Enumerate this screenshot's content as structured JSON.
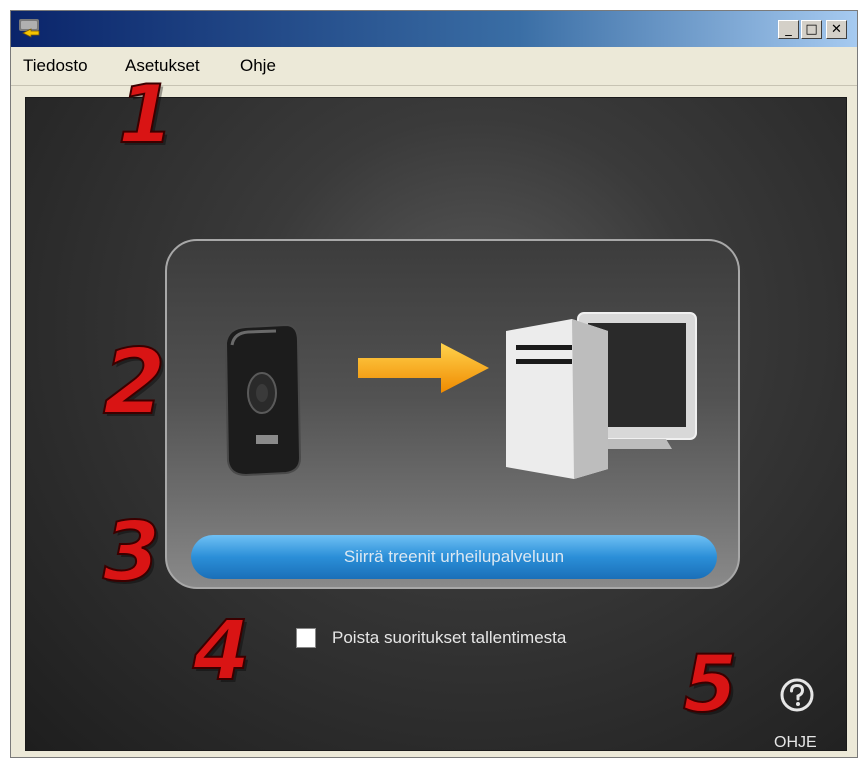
{
  "window": {
    "title": ""
  },
  "titlebar": {
    "min_glyph": "_",
    "max_glyph": "□",
    "close_glyph": "✕"
  },
  "menu": {
    "items": [
      "Tiedosto",
      "Asetukset",
      "Ohje"
    ]
  },
  "main": {
    "transfer_button_label": "Siirrä treenit urheilupalveluun",
    "delete_checkbox_label": "Poista suoritukset tallentimesta",
    "delete_checkbox_checked": false,
    "help_label": "OHJE"
  },
  "annotations": [
    "1",
    "2",
    "3",
    "4",
    "5"
  ],
  "colors": {
    "annotation": "#d91414",
    "button": "#2b8fd8",
    "arrow": "#f5a623"
  }
}
